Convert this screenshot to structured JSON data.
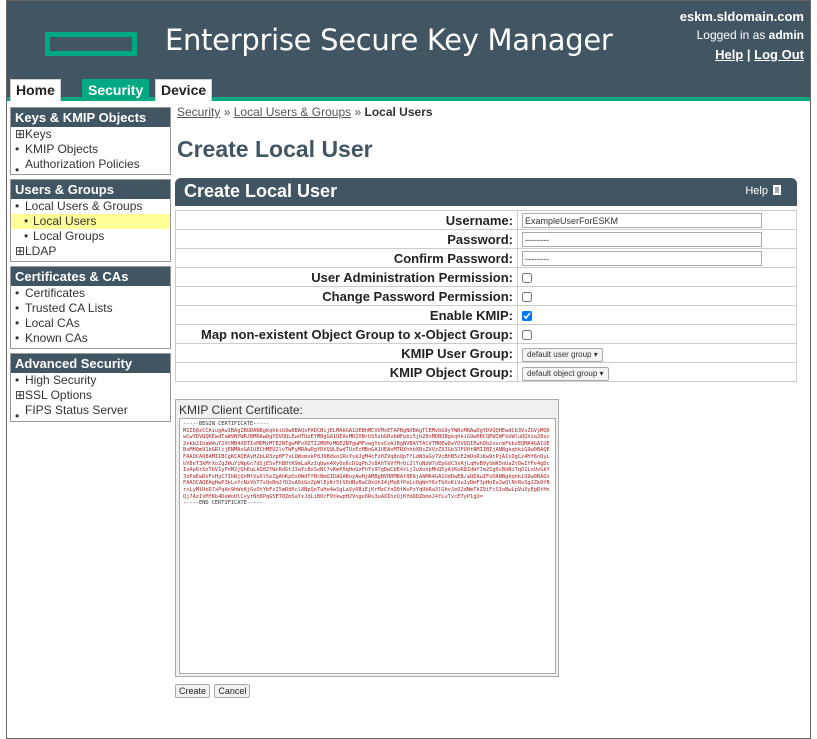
{
  "header": {
    "app_title": "Enterprise Secure Key Manager",
    "host": "eskm.sldomain.com",
    "logged_in_prefix": "Logged in as ",
    "logged_in_user": "admin",
    "help_link": "Help",
    "separator": " | ",
    "logout_link": "Log Out"
  },
  "nav": {
    "tabs": [
      {
        "label": "Home"
      },
      {
        "label": "Security"
      },
      {
        "label": "Device"
      }
    ]
  },
  "sidebar": {
    "sections": [
      {
        "title": "Keys & KMIP Objects",
        "items": [
          {
            "label": "Keys",
            "bullet": "⊞"
          },
          {
            "label": "KMIP Objects",
            "bullet": "•"
          },
          {
            "label": "Authorization Policies",
            "bullet": "•"
          }
        ]
      },
      {
        "title": "Users & Groups",
        "items": [
          {
            "label": "Local Users & Groups",
            "bullet": "•"
          },
          {
            "label": "Local Users",
            "bullet": "•"
          },
          {
            "label": "Local Groups",
            "bullet": "•"
          },
          {
            "label": "LDAP",
            "bullet": "⊞"
          }
        ]
      },
      {
        "title": "Certificates & CAs",
        "items": [
          {
            "label": "Certificates",
            "bullet": "•"
          },
          {
            "label": "Trusted CA Lists",
            "bullet": "•"
          },
          {
            "label": "Local CAs",
            "bullet": "•"
          },
          {
            "label": "Known CAs",
            "bullet": "•"
          }
        ]
      },
      {
        "title": "Advanced Security",
        "items": [
          {
            "label": "High Security",
            "bullet": "•"
          },
          {
            "label": "SSL Options",
            "bullet": "⊞"
          },
          {
            "label": "FIPS Status Server",
            "bullet": "•"
          }
        ]
      }
    ]
  },
  "breadcrumb": {
    "items": [
      "Security",
      "Local Users & Groups"
    ],
    "separator": "»",
    "current": "Local Users"
  },
  "page_title": "Create Local User",
  "panel": {
    "title": "Create Local User",
    "help": "Help",
    "help_icon": "document-icon"
  },
  "form": {
    "username_label": "Username:",
    "username_value": "ExampleUserForESKM",
    "password_label": "Password:",
    "password_value": "--------",
    "confirm_label": "Confirm Password:",
    "confirm_value": "--------",
    "user_admin_label": "User Administration Permission:",
    "user_admin_checked": false,
    "change_pw_label": "Change Password Permission:",
    "change_pw_checked": false,
    "enable_kmip_label": "Enable KMIP:",
    "enable_kmip_checked": true,
    "map_group_label": "Map non-existent Object Group to x-Object Group:",
    "map_group_checked": false,
    "kmip_user_group_label": "KMIP User Group:",
    "kmip_user_group_value": "default user group",
    "kmip_object_group_label": "KMIP Object Group:",
    "kmip_object_group_value": "default object group"
  },
  "certificate": {
    "label": "KMIP Client Certificate:",
    "begin": "-----BEGIN CERTIFICATE-----",
    "body": "MIIDQzCCAiugAwIBAgIBGDANBgkqhkiG9w0BAQsFADCBijELMAkGA1UEBhMCVVMxETAPBgNVBAgTCEMvbG9yYWRvMRAwDgYDVQQHEwdCb3VsZGVyMQ0wCwYDVQQKEwdTaW9NYWRJBMRAwDgYDVQQLEwdTUzEYMBgGA1UEAxMRZXNrbS5zbGRvbWFpbi5jb20xMDBQBgkqhkiG9w0BCQEWIWFkbWluQGVza20uc2xkb21haW4uY29tMB4XDTIxMDMzMTE2NTgwMFoXDTI2MDMzMDE2NTgwMFowgYoxCzAJBgNVBAYTAlVTMREwDwYDVQQIEwhDb2xvcmFkbzEQMA4GA1UEBxMHQm91bGRlcjENMAsGA1UEChMEU2lvTWFyMRAwDgYDVQQLEwdTUzEcMBoGA1UEAxMTRXhhbXBsZVVzZXJGb3JFU0tNMIIBIjANBgkqhkiG9w0BAQEFAAOCAQ8AMIIBCgKCAQEAyH2bLR3zp0F7vLQWsmxkP8J6Bdxe1RsYvkJgM4cFz0ZVq8nQpTfLdW3aGy7VcBhN5xE2mUoRiKw9tPjA1sDgCz4Hf6nQyLbV8eT3kMrXoZq2WuYiNpGc7dSjE5vFhB0tK9mLaRzIqUwn4XyOe6cD1gPbJs8AhTkVfMrQi2lYuNzW7oEpGdC3xRjLqHvB9ySmK5nUaZt0wIfFe4gDcIoAp6rXsTbV1yPnM2jQhEuLkO8ZfWcRdGtJ3aYiBxSeNl7vKmP0qHoUzFhYs9TgDwCbE4rLjIuXoVpMnQ5yAtKeR8ZdWfJm2Sg6cBhNiTqO1LxUvGkY3zPaEwDoFsHyC7IbRjQnMtVuXl5eZgAhKpOs0WdTfNcBmQIDAQABoyAwHjAMBgNVHRMBAf8EAjAAMA4GA1UdDwEB/wQEAwIFoDANBgkqhkiG9w0BAQsFAAOCAQEAgHwP3kLxYcNzVbT7sQeRmJfD2uA9iGoZpWlEyKr5tS0dNvBaC8xUhI4jMqRfPeLcOgWnY6zTbXsKiVu1yDmF3pHoEaJwQlNtRvSg2Zk0fBrcLyMiUeD7xPqAn9hWsKjGvOtYbFzI5mRdXcl8NpQeTuHo4wSgLaVy6BiEjKrMzCfnD0tWsPxYqUbRa3lGhvJeO2dNmTkZ9iFcS1oBwLpVuXyEgRtHnQj7AzIsMfKb4DeWoUlCvyrNh8PqG5ET0ZmSaYxJdLiBOcF9tkwpH2Vnge6Rs3uAXIhzQjKYmDDZbmoJ4fLvTxcE7yP1gU=",
    "end": "-----END CERTIFICATE-----"
  },
  "buttons": {
    "create": "Create",
    "cancel": "Cancel"
  },
  "colors": {
    "brand_dark": "#425563",
    "brand_green": "#01a982",
    "highlight": "#ffff99"
  }
}
